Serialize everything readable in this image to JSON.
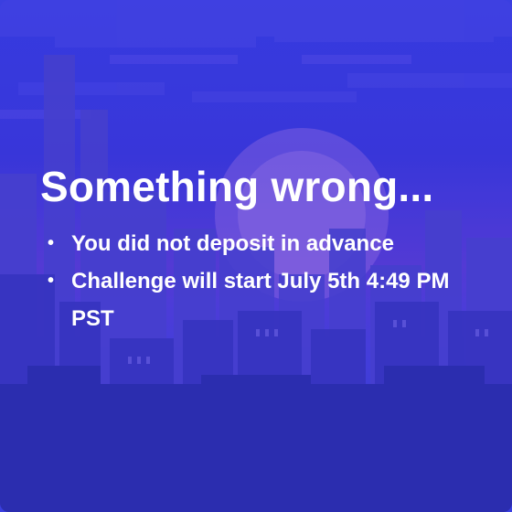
{
  "dialog": {
    "title": "Something wrong...",
    "items": [
      {
        "bullet": "•",
        "text": "You did not deposit in advance"
      },
      {
        "bullet": "•",
        "text": "Challenge will start July 5th 4:49 PM PST"
      }
    ]
  },
  "colors": {
    "background_top": "#3a40ee",
    "background_mid": "#5d3fe0",
    "text": "#ffffff"
  },
  "background": {
    "description_icon": "pixel-city-skyline-illustration"
  }
}
